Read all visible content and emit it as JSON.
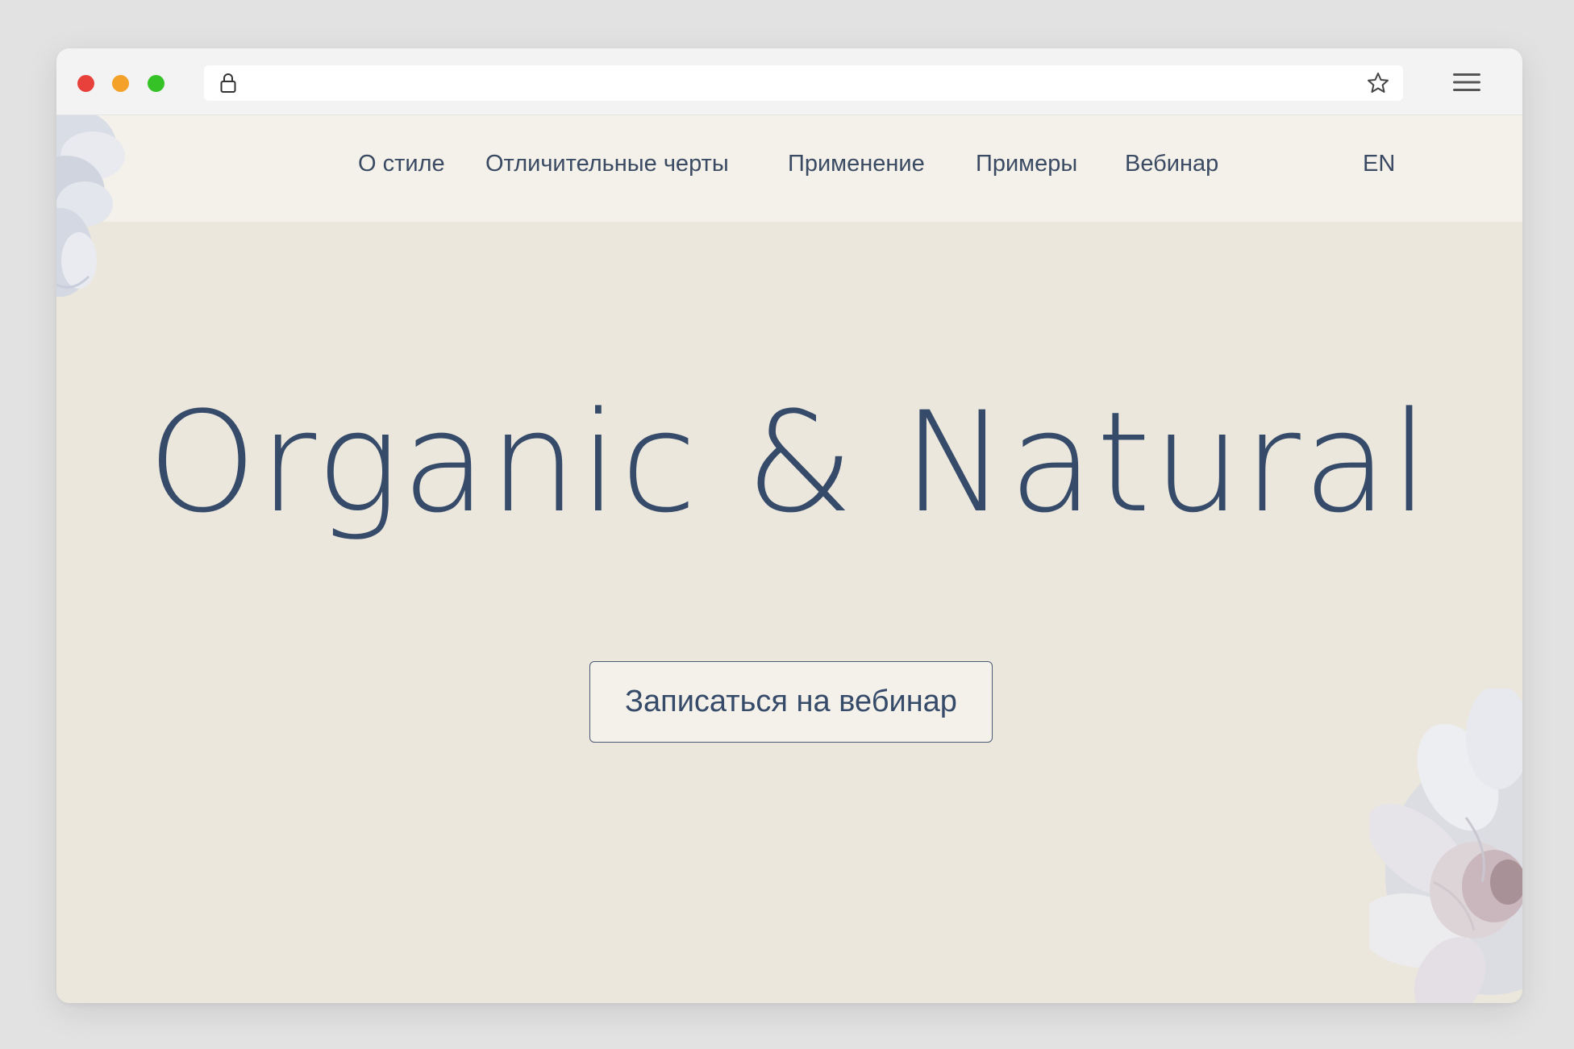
{
  "nav": {
    "items": [
      {
        "label": "О стиле"
      },
      {
        "label": "Отличительные черты"
      },
      {
        "label": "Применение"
      },
      {
        "label": "Примеры"
      },
      {
        "label": "Вебинар"
      }
    ],
    "lang": "EN"
  },
  "hero": {
    "title": "Organic & Natural",
    "cta_label": "Записаться на вебинар"
  },
  "colors": {
    "text": "#364a6a",
    "background": "#ebe7dc",
    "navbar": "#f4f1ea"
  },
  "icons": [
    "lock-icon",
    "star-icon",
    "hamburger-menu-icon",
    "flower-decoration"
  ]
}
